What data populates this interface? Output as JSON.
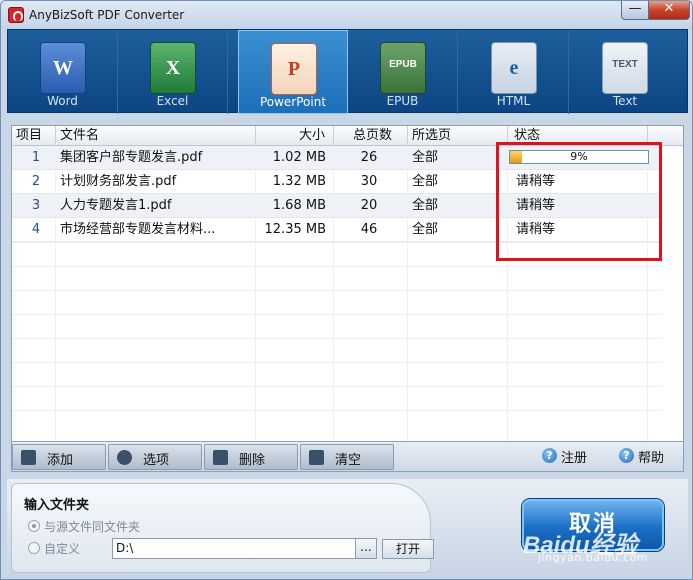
{
  "window": {
    "title": "AnyBizSoft PDF Converter",
    "minimize": "—",
    "close": "✕"
  },
  "tabs": [
    {
      "label": "Word",
      "glyph": "W"
    },
    {
      "label": "Excel",
      "glyph": "X"
    },
    {
      "label": "PowerPoint",
      "glyph": "P"
    },
    {
      "label": "EPUB",
      "glyph": "EPUB"
    },
    {
      "label": "HTML",
      "glyph": "e"
    },
    {
      "label": "Text",
      "glyph": "TEXT"
    }
  ],
  "active_tab": "PowerPoint",
  "table": {
    "headers": {
      "index": "项目",
      "name": "文件名",
      "size": "大小",
      "pages": "总页数",
      "selected": "所选页",
      "status": "状态"
    },
    "rows": [
      {
        "index": "1",
        "name": "集团客户部专题发言.pdf",
        "size": "1.02  MB",
        "pages": "26",
        "selected": "全部",
        "progress_percent": 9,
        "progress_label": "9%"
      },
      {
        "index": "2",
        "name": "计划财务部发言.pdf",
        "size": "1.32  MB",
        "pages": "30",
        "selected": "全部",
        "status": "请稍等"
      },
      {
        "index": "3",
        "name": "人力专题发言1.pdf",
        "size": "1.68  MB",
        "pages": "20",
        "selected": "全部",
        "status": "请稍等"
      },
      {
        "index": "4",
        "name": "市场经营部专题发言材料...",
        "size": "12.35  MB",
        "pages": "46",
        "selected": "全部",
        "status": "请稍等"
      }
    ]
  },
  "actions": {
    "add": "添加",
    "options": "选项",
    "delete": "删除",
    "clear": "清空",
    "register": "注册",
    "help": "帮助"
  },
  "output": {
    "title": "输入文件夹",
    "same_folder": "与源文件同文件夹",
    "custom": "自定义",
    "path": "D:\\",
    "browse": "...",
    "open": "打开"
  },
  "cancel_button": "取消",
  "watermark": {
    "brand": "Baidu经验",
    "url": "jingyan.baidu.com"
  },
  "colors": {
    "accent": "#1c6fb8",
    "highlight": "#e0101c",
    "progress": "#e69a10"
  }
}
